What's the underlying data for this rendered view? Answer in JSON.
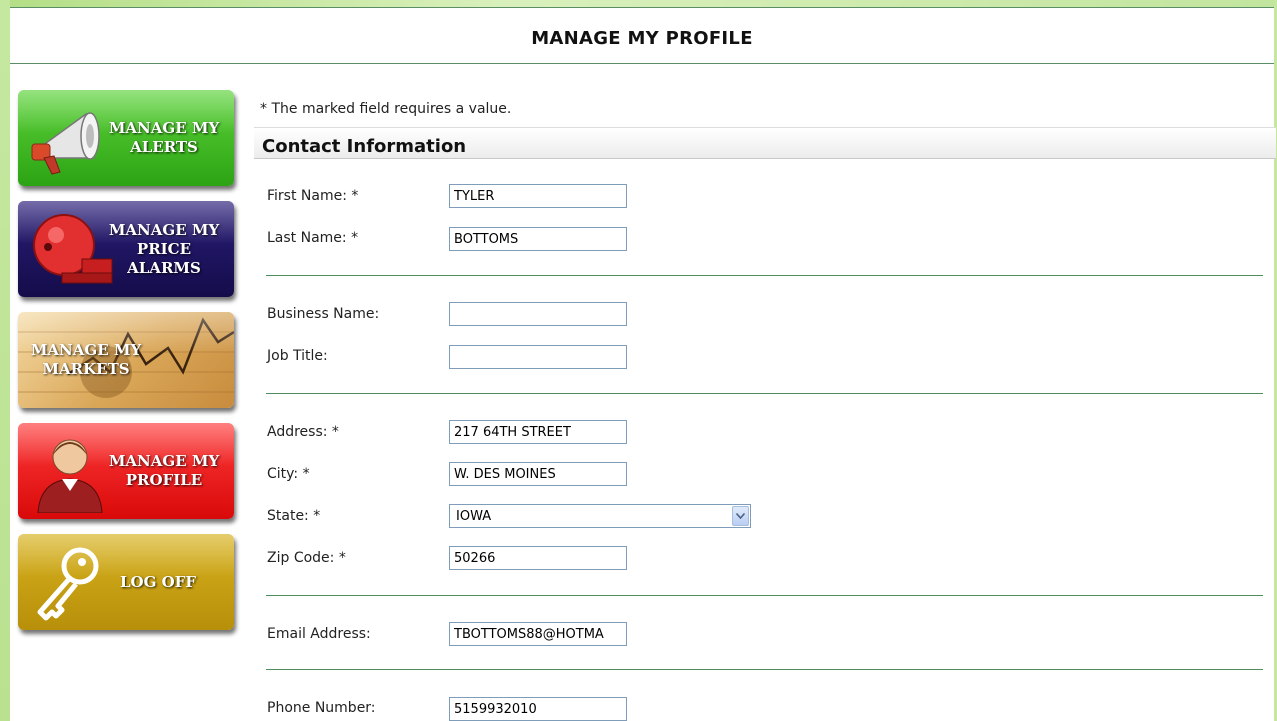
{
  "page": {
    "title": "MANAGE MY PROFILE"
  },
  "nav": {
    "alerts": {
      "label": "MANAGE MY ALERTS",
      "icon": "megaphone-icon",
      "color": "#2ca313"
    },
    "alarms": {
      "label": "MANAGE MY PRICE ALARMS",
      "icon": "alarm-bell-icon",
      "color": "#140c4a"
    },
    "markets": {
      "label": "MANAGE MY MARKETS",
      "icon": "market-chart-icon",
      "color": "#d9a657"
    },
    "profile": {
      "label": "MANAGE MY PROFILE",
      "icon": "user-icon",
      "color": "#d90909"
    },
    "logoff": {
      "label": "LOG OFF",
      "icon": "key-icon",
      "color": "#b78f0a"
    }
  },
  "form": {
    "required_note": "* The marked field requires a value.",
    "section_title": "Contact Information",
    "first_name": {
      "label": "First Name: *",
      "value": "TYLER"
    },
    "last_name": {
      "label": "Last Name: *",
      "value": "BOTTOMS"
    },
    "business_name": {
      "label": "Business Name:",
      "value": ""
    },
    "job_title": {
      "label": "Job Title:",
      "value": ""
    },
    "address": {
      "label": "Address: *",
      "value": "217 64TH STREET"
    },
    "city": {
      "label": "City: *",
      "value": "W. DES MOINES"
    },
    "state": {
      "label": "State: *",
      "value": "IOWA"
    },
    "zip": {
      "label": "Zip Code: *",
      "value": "50266"
    },
    "email": {
      "label": "Email Address:",
      "value": "TBOTTOMS88@HOTMA"
    },
    "phone": {
      "label": "Phone Number:",
      "value": "5159932010"
    }
  },
  "colors": {
    "accent_line": "#4f8c5f",
    "frame": "#c5e8a1",
    "input_border": "#7f9db9"
  }
}
